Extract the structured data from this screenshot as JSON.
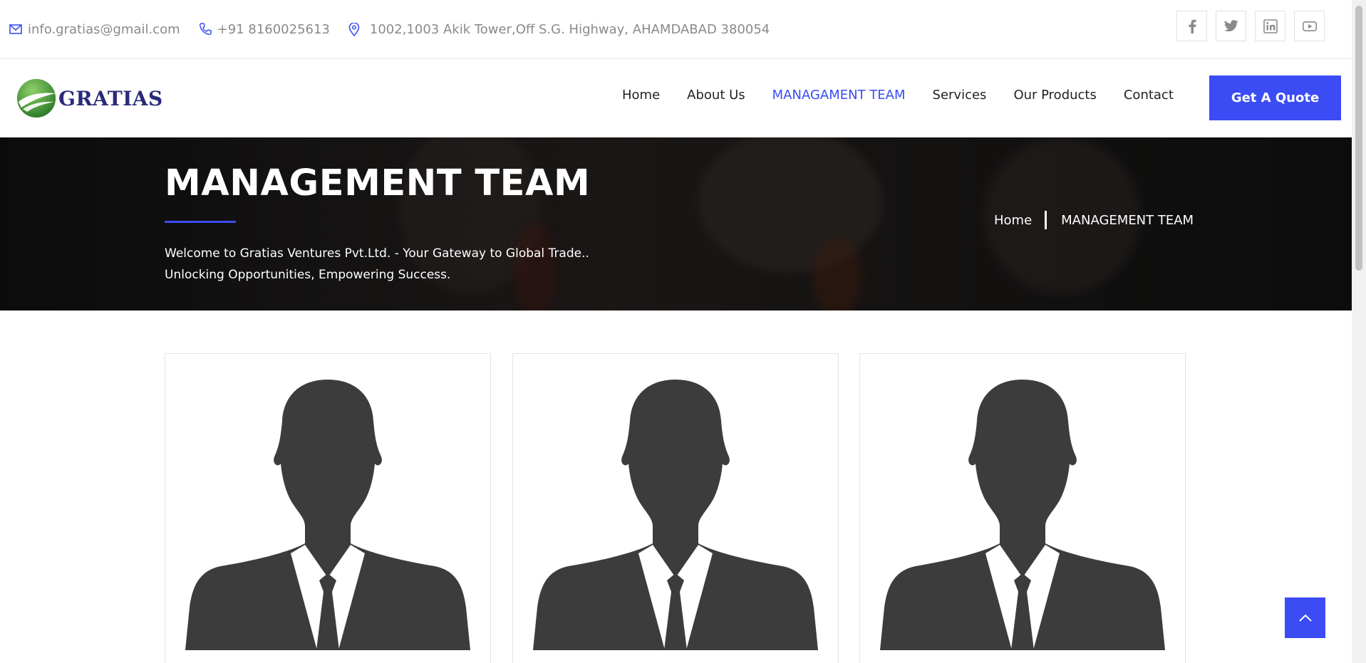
{
  "topbar": {
    "email": "info.gratias@gmail.com",
    "phone": "+91 8160025613",
    "address": "1002,1003 Akik Tower,Off S.G. Highway, AHAMDABAD 380054",
    "socials": [
      "facebook-icon",
      "twitter-icon",
      "linkedin-icon",
      "youtube-icon"
    ]
  },
  "header": {
    "logo_text": "GRATIAS",
    "nav": [
      {
        "label": "Home"
      },
      {
        "label": "About Us"
      },
      {
        "label": "MANAGAMENT TEAM",
        "active": true
      },
      {
        "label": "Services"
      },
      {
        "label": "Our Products"
      },
      {
        "label": "Contact"
      }
    ],
    "cta": "Get A Quote"
  },
  "hero": {
    "title": "MANAGEMENT TEAM",
    "subtitle_line1": "Welcome to Gratias Ventures Pvt.Ltd. - Your Gateway to Global Trade..",
    "subtitle_line2": "Unlocking Opportunities, Empowering Success.",
    "breadcrumb": [
      "Home",
      "MANAGEMENT TEAM"
    ]
  },
  "team": {
    "cards": [
      {
        "image": "person-silhouette"
      },
      {
        "image": "person-silhouette"
      },
      {
        "image": "person-silhouette"
      }
    ]
  },
  "colors": {
    "accent": "#3b4cf5",
    "nav_active": "#3a4cf0",
    "muted_text": "#8a8a8a",
    "silhouette": "#3c3c3c"
  }
}
